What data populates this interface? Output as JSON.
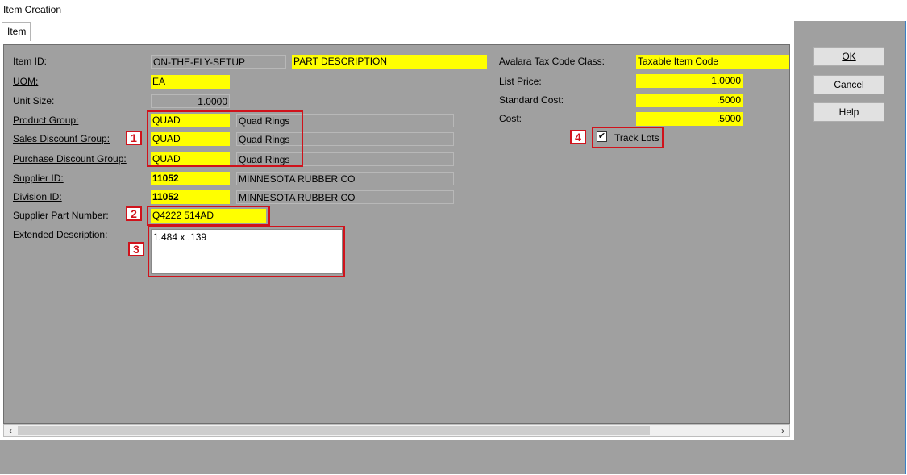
{
  "window": {
    "title": "Item Creation"
  },
  "tabs": [
    {
      "label": "Item"
    }
  ],
  "form": {
    "item_id": {
      "label": "Item ID:",
      "value": "ON-THE-FLY-SETUP",
      "description": "PART DESCRIPTION"
    },
    "uom": {
      "label": "UOM:",
      "value": "EA"
    },
    "unit_size": {
      "label": "Unit Size:",
      "value": "1.0000"
    },
    "product_group": {
      "label": "Product Group:",
      "code": "QUAD",
      "name": "Quad Rings"
    },
    "sales_discount_group": {
      "label": "Sales Discount Group:",
      "code": "QUAD",
      "name": "Quad Rings"
    },
    "purchase_discount_group": {
      "label": "Purchase Discount Group:",
      "code": "QUAD",
      "name": "Quad Rings"
    },
    "supplier_id": {
      "label": "Supplier ID:",
      "code": "11052",
      "name": "MINNESOTA RUBBER CO"
    },
    "division_id": {
      "label": "Division ID:",
      "code": "11052",
      "name": "MINNESOTA RUBBER CO"
    },
    "supplier_part_number": {
      "label": "Supplier Part Number:",
      "value": "Q4222 514AD"
    },
    "extended_description": {
      "label": "Extended Description:",
      "value": "1.484 x .139"
    },
    "avalara_tax_code_class": {
      "label": "Avalara Tax Code Class:",
      "value": "Taxable Item Code"
    },
    "list_price": {
      "label": "List Price:",
      "value": "1.0000"
    },
    "standard_cost": {
      "label": "Standard Cost:",
      "value": ".5000"
    },
    "cost": {
      "label": "Cost:",
      "value": ".5000"
    },
    "track_lots": {
      "label": "Track Lots",
      "checked": true
    }
  },
  "buttons": {
    "ok": "OK",
    "cancel": "Cancel",
    "help": "Help"
  },
  "callouts": [
    "1",
    "2",
    "3",
    "4"
  ],
  "colors": {
    "highlight": "#ffff00",
    "annotation": "#d0121b",
    "panel": "#a0a0a0"
  },
  "icons": {
    "scroll_left": "chevron-left-icon",
    "scroll_right": "chevron-right-icon",
    "check": "checkmark-icon"
  }
}
